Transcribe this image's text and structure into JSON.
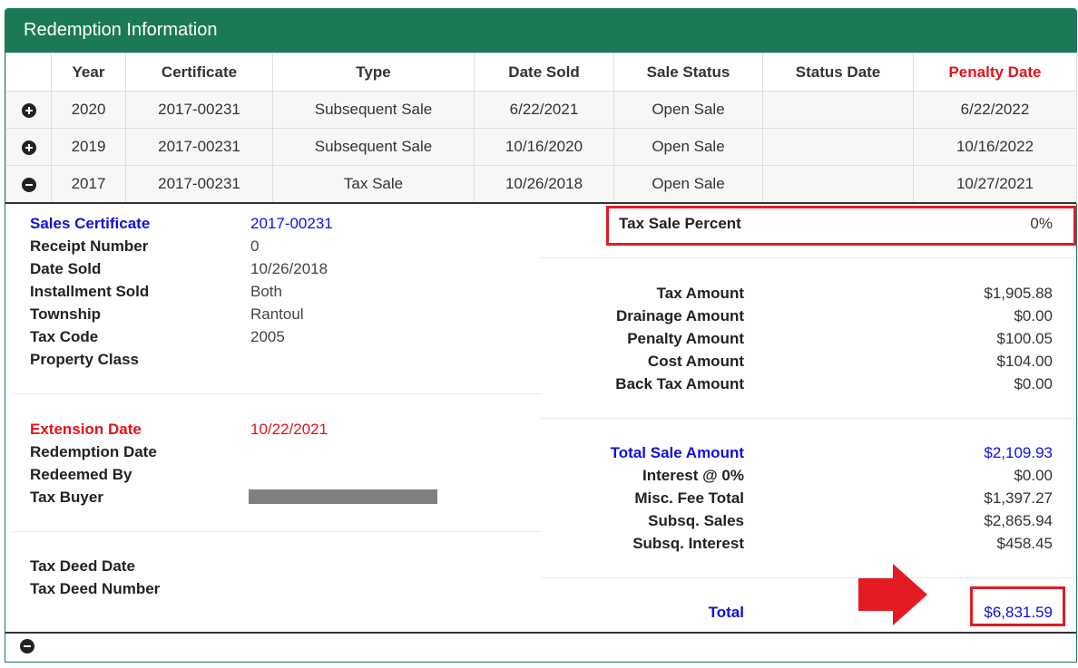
{
  "panel": {
    "title": "Redemption Information"
  },
  "table": {
    "headers": [
      "",
      "Year",
      "Certificate",
      "Type",
      "Date Sold",
      "Sale Status",
      "Status Date",
      "Penalty Date"
    ],
    "rows": [
      {
        "icon": "plus-circle-icon",
        "year": "2020",
        "certificate": "2017-00231",
        "type": "Subsequent Sale",
        "date_sold": "6/22/2021",
        "sale_status": "Open Sale",
        "status_date": "",
        "penalty_date": "6/22/2022"
      },
      {
        "icon": "plus-circle-icon",
        "year": "2019",
        "certificate": "2017-00231",
        "type": "Subsequent Sale",
        "date_sold": "10/16/2020",
        "sale_status": "Open Sale",
        "status_date": "",
        "penalty_date": "10/16/2022"
      },
      {
        "icon": "minus-circle-icon",
        "year": "2017",
        "certificate": "2017-00231",
        "type": "Tax Sale",
        "date_sold": "10/26/2018",
        "sale_status": "Open Sale",
        "status_date": "",
        "penalty_date": "10/27/2021"
      }
    ]
  },
  "detail": {
    "left": {
      "sales_certificate_label": "Sales Certificate",
      "sales_certificate": "2017-00231",
      "receipt_number_label": "Receipt Number",
      "receipt_number": "0",
      "date_sold_label": "Date Sold",
      "date_sold": "10/26/2018",
      "installment_sold_label": "Installment Sold",
      "installment_sold": "Both",
      "township_label": "Township",
      "township": "Rantoul",
      "tax_code_label": "Tax Code",
      "tax_code": "2005",
      "property_class_label": "Property Class",
      "extension_date_label": "Extension Date",
      "extension_date": "10/22/2021",
      "redemption_date_label": "Redemption Date",
      "redeemed_by_label": "Redeemed By",
      "tax_buyer_label": "Tax Buyer",
      "tax_deed_date_label": "Tax Deed Date",
      "tax_deed_number_label": "Tax Deed Number"
    },
    "right": {
      "tax_sale_percent_label": "Tax Sale Percent",
      "tax_sale_percent": "0%",
      "tax_amount_label": "Tax Amount",
      "tax_amount": "$1,905.88",
      "drainage_amount_label": "Drainage Amount",
      "drainage_amount": "$0.00",
      "penalty_amount_label": "Penalty Amount",
      "penalty_amount": "$100.05",
      "cost_amount_label": "Cost Amount",
      "cost_amount": "$104.00",
      "back_tax_amount_label": "Back Tax Amount",
      "back_tax_amount": "$0.00",
      "total_sale_amount_label": "Total Sale Amount",
      "total_sale_amount": "$2,109.93",
      "interest_label": "Interest @ 0%",
      "interest": "$0.00",
      "misc_fee_total_label": "Misc. Fee Total",
      "misc_fee_total": "$1,397.27",
      "subsq_sales_label": "Subsq. Sales",
      "subsq_sales": "$2,865.94",
      "subsq_interest_label": "Subsq. Interest",
      "subsq_interest": "$458.45",
      "total_label": "Total",
      "total": "$6,831.59"
    }
  },
  "colors": {
    "header_green": "#1b7a55",
    "penalty_red": "#e8101a",
    "link_blue": "#1010e0",
    "highlight_red": "#e31b23"
  }
}
